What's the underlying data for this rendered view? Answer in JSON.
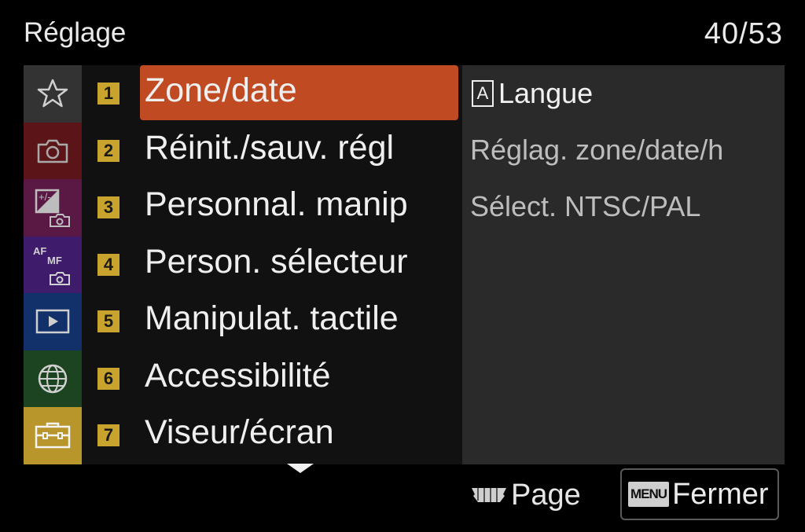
{
  "header": {
    "title": "Réglage",
    "page_counter": "40/53"
  },
  "tabs": [
    {
      "icon": "star-icon",
      "bg": "#333333",
      "selected": false
    },
    {
      "icon": "camera-icon",
      "bg": "#5b1518",
      "selected": false
    },
    {
      "icon": "exposure-camera-icon",
      "bg": "#5a1845",
      "selected": false
    },
    {
      "icon": "af-mf-camera-icon",
      "bg": "#3f1c6b",
      "selected": false
    },
    {
      "icon": "playback-icon",
      "bg": "#12306a",
      "selected": false
    },
    {
      "icon": "globe-icon",
      "bg": "#1d4420",
      "selected": false
    },
    {
      "icon": "toolbox-icon",
      "bg": "#b8962b",
      "selected": true
    }
  ],
  "menu_items": [
    {
      "num": "1",
      "label": "Zone/date",
      "selected": true
    },
    {
      "num": "2",
      "label": "Réinit./sauv. régl",
      "selected": false
    },
    {
      "num": "3",
      "label": "Personnal. manip",
      "selected": false
    },
    {
      "num": "4",
      "label": "Person. sélecteur",
      "selected": false
    },
    {
      "num": "5",
      "label": "Manipulat. tactile",
      "selected": false
    },
    {
      "num": "6",
      "label": "Accessibilité",
      "selected": false
    },
    {
      "num": "7",
      "label": "Viseur/écran",
      "selected": false
    }
  ],
  "submenu": {
    "items": [
      {
        "icon_letter": "A",
        "label": "Langue"
      },
      {
        "label": "Réglag. zone/date/h"
      },
      {
        "label": "Sélect. NTSC/PAL"
      }
    ]
  },
  "footer": {
    "page_label": "Page",
    "close_badge": "MENU",
    "close_label": "Fermer"
  },
  "colors": {
    "accent_selection": "#c04b22",
    "number_badge": "#c8a32d",
    "background": "#000000"
  }
}
